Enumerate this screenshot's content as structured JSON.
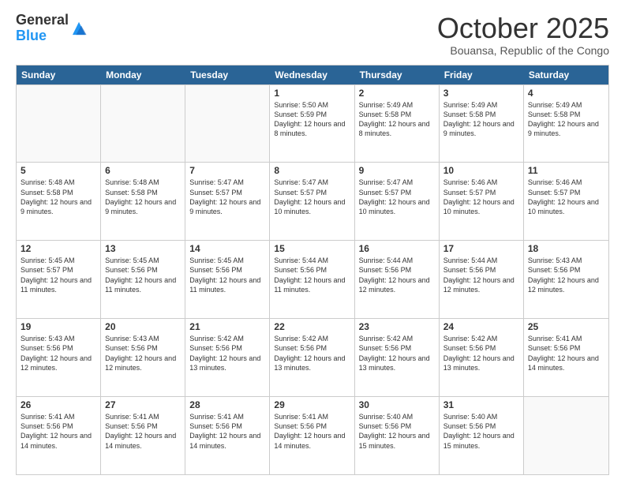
{
  "header": {
    "logo_general": "General",
    "logo_blue": "Blue",
    "month_title": "October 2025",
    "location": "Bouansa, Republic of the Congo"
  },
  "calendar": {
    "days_of_week": [
      "Sunday",
      "Monday",
      "Tuesday",
      "Wednesday",
      "Thursday",
      "Friday",
      "Saturday"
    ],
    "rows": [
      [
        {
          "day": "",
          "empty": true
        },
        {
          "day": "",
          "empty": true
        },
        {
          "day": "",
          "empty": true
        },
        {
          "day": "1",
          "sunrise": "5:50 AM",
          "sunset": "5:59 PM",
          "daylight": "12 hours and 8 minutes."
        },
        {
          "day": "2",
          "sunrise": "5:49 AM",
          "sunset": "5:58 PM",
          "daylight": "12 hours and 8 minutes."
        },
        {
          "day": "3",
          "sunrise": "5:49 AM",
          "sunset": "5:58 PM",
          "daylight": "12 hours and 9 minutes."
        },
        {
          "day": "4",
          "sunrise": "5:49 AM",
          "sunset": "5:58 PM",
          "daylight": "12 hours and 9 minutes."
        }
      ],
      [
        {
          "day": "5",
          "sunrise": "5:48 AM",
          "sunset": "5:58 PM",
          "daylight": "12 hours and 9 minutes."
        },
        {
          "day": "6",
          "sunrise": "5:48 AM",
          "sunset": "5:58 PM",
          "daylight": "12 hours and 9 minutes."
        },
        {
          "day": "7",
          "sunrise": "5:47 AM",
          "sunset": "5:57 PM",
          "daylight": "12 hours and 9 minutes."
        },
        {
          "day": "8",
          "sunrise": "5:47 AM",
          "sunset": "5:57 PM",
          "daylight": "12 hours and 10 minutes."
        },
        {
          "day": "9",
          "sunrise": "5:47 AM",
          "sunset": "5:57 PM",
          "daylight": "12 hours and 10 minutes."
        },
        {
          "day": "10",
          "sunrise": "5:46 AM",
          "sunset": "5:57 PM",
          "daylight": "12 hours and 10 minutes."
        },
        {
          "day": "11",
          "sunrise": "5:46 AM",
          "sunset": "5:57 PM",
          "daylight": "12 hours and 10 minutes."
        }
      ],
      [
        {
          "day": "12",
          "sunrise": "5:45 AM",
          "sunset": "5:57 PM",
          "daylight": "12 hours and 11 minutes."
        },
        {
          "day": "13",
          "sunrise": "5:45 AM",
          "sunset": "5:56 PM",
          "daylight": "12 hours and 11 minutes."
        },
        {
          "day": "14",
          "sunrise": "5:45 AM",
          "sunset": "5:56 PM",
          "daylight": "12 hours and 11 minutes."
        },
        {
          "day": "15",
          "sunrise": "5:44 AM",
          "sunset": "5:56 PM",
          "daylight": "12 hours and 11 minutes."
        },
        {
          "day": "16",
          "sunrise": "5:44 AM",
          "sunset": "5:56 PM",
          "daylight": "12 hours and 12 minutes."
        },
        {
          "day": "17",
          "sunrise": "5:44 AM",
          "sunset": "5:56 PM",
          "daylight": "12 hours and 12 minutes."
        },
        {
          "day": "18",
          "sunrise": "5:43 AM",
          "sunset": "5:56 PM",
          "daylight": "12 hours and 12 minutes."
        }
      ],
      [
        {
          "day": "19",
          "sunrise": "5:43 AM",
          "sunset": "5:56 PM",
          "daylight": "12 hours and 12 minutes."
        },
        {
          "day": "20",
          "sunrise": "5:43 AM",
          "sunset": "5:56 PM",
          "daylight": "12 hours and 12 minutes."
        },
        {
          "day": "21",
          "sunrise": "5:42 AM",
          "sunset": "5:56 PM",
          "daylight": "12 hours and 13 minutes."
        },
        {
          "day": "22",
          "sunrise": "5:42 AM",
          "sunset": "5:56 PM",
          "daylight": "12 hours and 13 minutes."
        },
        {
          "day": "23",
          "sunrise": "5:42 AM",
          "sunset": "5:56 PM",
          "daylight": "12 hours and 13 minutes."
        },
        {
          "day": "24",
          "sunrise": "5:42 AM",
          "sunset": "5:56 PM",
          "daylight": "12 hours and 13 minutes."
        },
        {
          "day": "25",
          "sunrise": "5:41 AM",
          "sunset": "5:56 PM",
          "daylight": "12 hours and 14 minutes."
        }
      ],
      [
        {
          "day": "26",
          "sunrise": "5:41 AM",
          "sunset": "5:56 PM",
          "daylight": "12 hours and 14 minutes."
        },
        {
          "day": "27",
          "sunrise": "5:41 AM",
          "sunset": "5:56 PM",
          "daylight": "12 hours and 14 minutes."
        },
        {
          "day": "28",
          "sunrise": "5:41 AM",
          "sunset": "5:56 PM",
          "daylight": "12 hours and 14 minutes."
        },
        {
          "day": "29",
          "sunrise": "5:41 AM",
          "sunset": "5:56 PM",
          "daylight": "12 hours and 14 minutes."
        },
        {
          "day": "30",
          "sunrise": "5:40 AM",
          "sunset": "5:56 PM",
          "daylight": "12 hours and 15 minutes."
        },
        {
          "day": "31",
          "sunrise": "5:40 AM",
          "sunset": "5:56 PM",
          "daylight": "12 hours and 15 minutes."
        },
        {
          "day": "",
          "empty": true
        }
      ]
    ]
  }
}
